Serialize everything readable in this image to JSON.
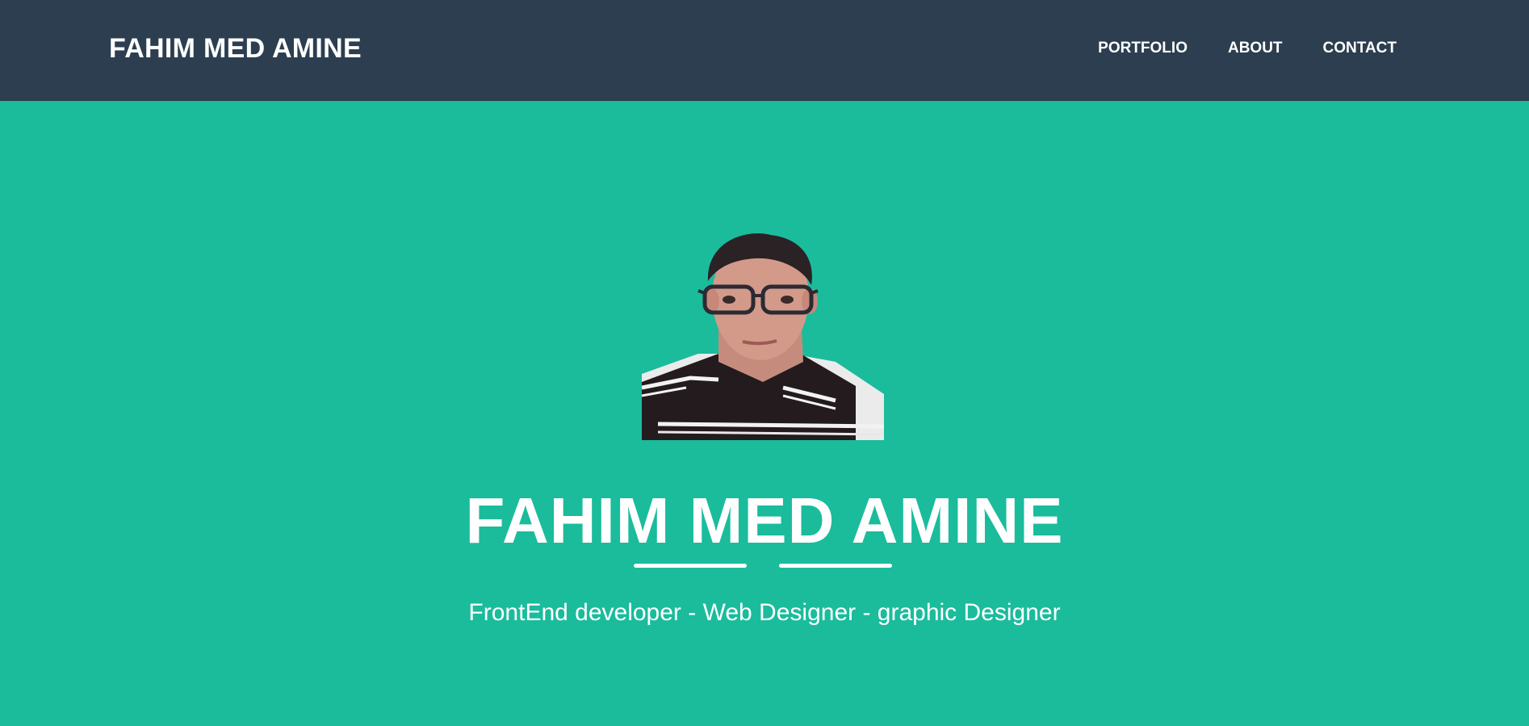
{
  "header": {
    "brand": "FAHIM MED AMINE",
    "nav": [
      {
        "label": "PORTFOLIO"
      },
      {
        "label": "ABOUT"
      },
      {
        "label": "CONTACT"
      }
    ]
  },
  "hero": {
    "title": "FAHIM MED AMINE",
    "subtitle": "FrontEnd developer - Web Designer - graphic Designer"
  },
  "colors": {
    "navbar": "#2c3e50",
    "hero_background": "#1abc9c",
    "text": "#ffffff"
  }
}
